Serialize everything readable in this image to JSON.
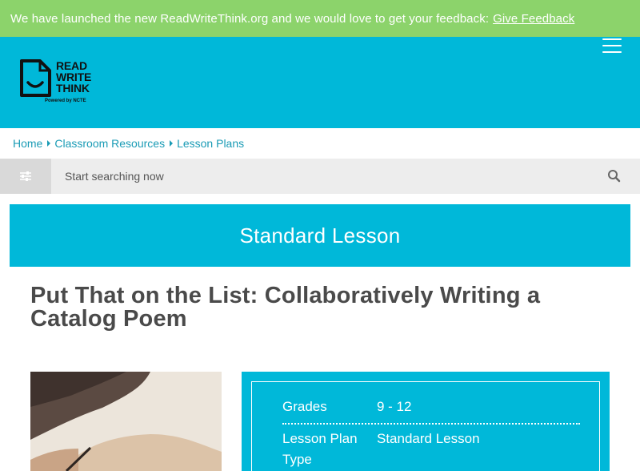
{
  "banner": {
    "message": "We have launched the new ReadWriteThink.org and we would love to get your feedback:",
    "link_label": "Give Feedback"
  },
  "header": {
    "logo": {
      "line1": "READ",
      "line2": "WRITE",
      "line3": "THINK",
      "powered_by": "Powered by NCTE"
    },
    "menu_icon": "hamburger-menu-icon",
    "background": "#00b8d9"
  },
  "breadcrumb": {
    "items": [
      "Home",
      "Classroom Resources",
      "Lesson Plans"
    ]
  },
  "search": {
    "placeholder": "Start searching now",
    "filter_icon": "sliders-icon",
    "search_icon": "search-icon"
  },
  "lesson_type_banner": "Standard Lesson",
  "title": "Put That on the List: Collaboratively Writing a Catalog Poem",
  "info": {
    "rows": [
      {
        "label": "Grades",
        "value": "9 - 12"
      },
      {
        "label": "Lesson Plan Type",
        "value": "Standard Lesson"
      }
    ]
  },
  "colors": {
    "banner": "#8cd36b",
    "accent": "#00b8d9",
    "link": "#1a9bb5",
    "title": "#4a4a4a"
  }
}
